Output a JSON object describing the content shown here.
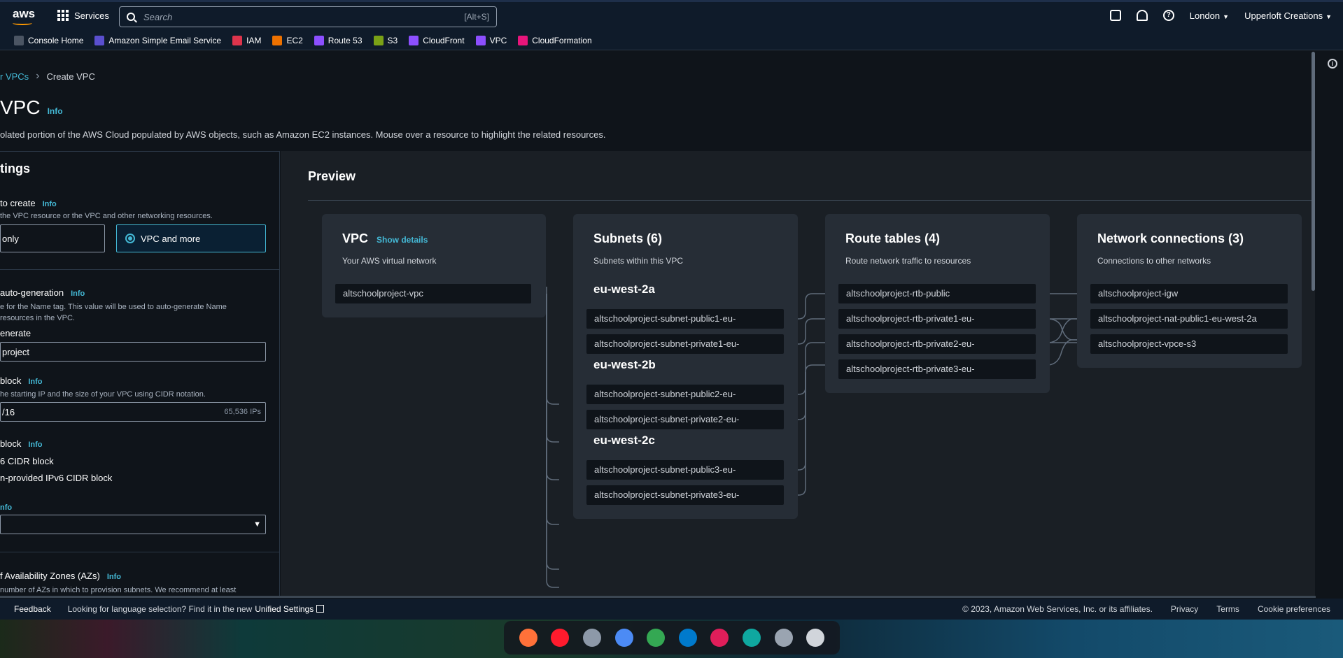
{
  "topnav": {
    "logo": "aws",
    "services_label": "Services",
    "search_placeholder": "Search",
    "search_shortcut": "[Alt+S]",
    "region": "London",
    "account": "Upperloft Creations"
  },
  "favorites": [
    {
      "label": "Console Home",
      "color": "#4b5563"
    },
    {
      "label": "Amazon Simple Email Service",
      "color": "#5a4fcf"
    },
    {
      "label": "IAM",
      "color": "#dd344c"
    },
    {
      "label": "EC2",
      "color": "#ed7100"
    },
    {
      "label": "Route 53",
      "color": "#8c4fff"
    },
    {
      "label": "S3",
      "color": "#7aa116"
    },
    {
      "label": "CloudFront",
      "color": "#8c4fff"
    },
    {
      "label": "VPC",
      "color": "#8c4fff"
    },
    {
      "label": "CloudFormation",
      "color": "#e7157b"
    }
  ],
  "breadcrumb": {
    "parent": "r VPCs",
    "current": "Create VPC"
  },
  "page": {
    "title": "VPC",
    "info": "Info",
    "description": "olated portion of the AWS Cloud populated by AWS objects, such as Amazon EC2 instances. Mouse over a resource to highlight the related resources."
  },
  "settings": {
    "heading": "tings",
    "resources_label": "to create",
    "resources_info": "Info",
    "resources_help": "the VPC resource or the VPC and other networking resources.",
    "option_only": "only",
    "option_more": "VPC and more",
    "autogen_label": "auto-generation",
    "autogen_info": "Info",
    "autogen_help1": "e for the Name tag. This value will be used to auto-generate Name",
    "autogen_help2": "resources in the VPC.",
    "autogen_check": "enerate",
    "autogen_value": "project",
    "ipv4_label": "block",
    "ipv4_info": "Info",
    "ipv4_help": "he starting IP and the size of your VPC using CIDR notation.",
    "ipv4_value": "/16",
    "ipv4_suffix": "65,536 IPs",
    "ipv6_label": "block",
    "ipv6_info": "Info",
    "ipv6_opt1": "6 CIDR block",
    "ipv6_opt2": "n-provided IPv6 CIDR block",
    "tenancy_info": "nfo",
    "az_label": "f Availability Zones (AZs)",
    "az_info": "Info",
    "az_help": "number of AZs in which to provision subnets. We recommend at least"
  },
  "preview": {
    "heading": "Preview",
    "vpc": {
      "title": "VPC",
      "details": "Show details",
      "subtitle": "Your AWS virtual network",
      "name": "altschoolproject-vpc"
    },
    "subnets": {
      "title": "Subnets (6)",
      "subtitle": "Subnets within this VPC",
      "zones": [
        {
          "name": "eu-west-2a",
          "items": [
            "altschoolproject-subnet-public1-eu-",
            "altschoolproject-subnet-private1-eu-"
          ]
        },
        {
          "name": "eu-west-2b",
          "items": [
            "altschoolproject-subnet-public2-eu-",
            "altschoolproject-subnet-private2-eu-"
          ]
        },
        {
          "name": "eu-west-2c",
          "items": [
            "altschoolproject-subnet-public3-eu-",
            "altschoolproject-subnet-private3-eu-"
          ]
        }
      ]
    },
    "routes": {
      "title": "Route tables (4)",
      "subtitle": "Route network traffic to resources",
      "items": [
        "altschoolproject-rtb-public",
        "altschoolproject-rtb-private1-eu-",
        "altschoolproject-rtb-private2-eu-",
        "altschoolproject-rtb-private3-eu-"
      ]
    },
    "connections": {
      "title": "Network connections (3)",
      "subtitle": "Connections to other networks",
      "items": [
        "altschoolproject-igw",
        "altschoolproject-nat-public1-eu-west-2a",
        "altschoolproject-vpce-s3"
      ]
    }
  },
  "footer": {
    "feedback": "Feedback",
    "lang_text": "Looking for language selection? Find it in the new",
    "unified": "Unified Settings",
    "copyright": "© 2023, Amazon Web Services, Inc. or its affiliates.",
    "privacy": "Privacy",
    "terms": "Terms",
    "cookies": "Cookie preferences"
  },
  "dock": [
    {
      "name": "firefox-icon",
      "color": "#ff7139"
    },
    {
      "name": "opera-icon",
      "color": "#ff1b2d"
    },
    {
      "name": "files-icon",
      "color": "#8d99a8"
    },
    {
      "name": "chromium-icon",
      "color": "#4c8bf5"
    },
    {
      "name": "chrome-icon",
      "color": "#34a853"
    },
    {
      "name": "vscode-icon",
      "color": "#007acc"
    },
    {
      "name": "slack-icon",
      "color": "#e01e5a"
    },
    {
      "name": "edge-icon",
      "color": "#0fa8a0"
    },
    {
      "name": "trash-icon",
      "color": "#9aa4b1"
    },
    {
      "name": "app-grid-icon",
      "color": "#d1d5db"
    }
  ]
}
